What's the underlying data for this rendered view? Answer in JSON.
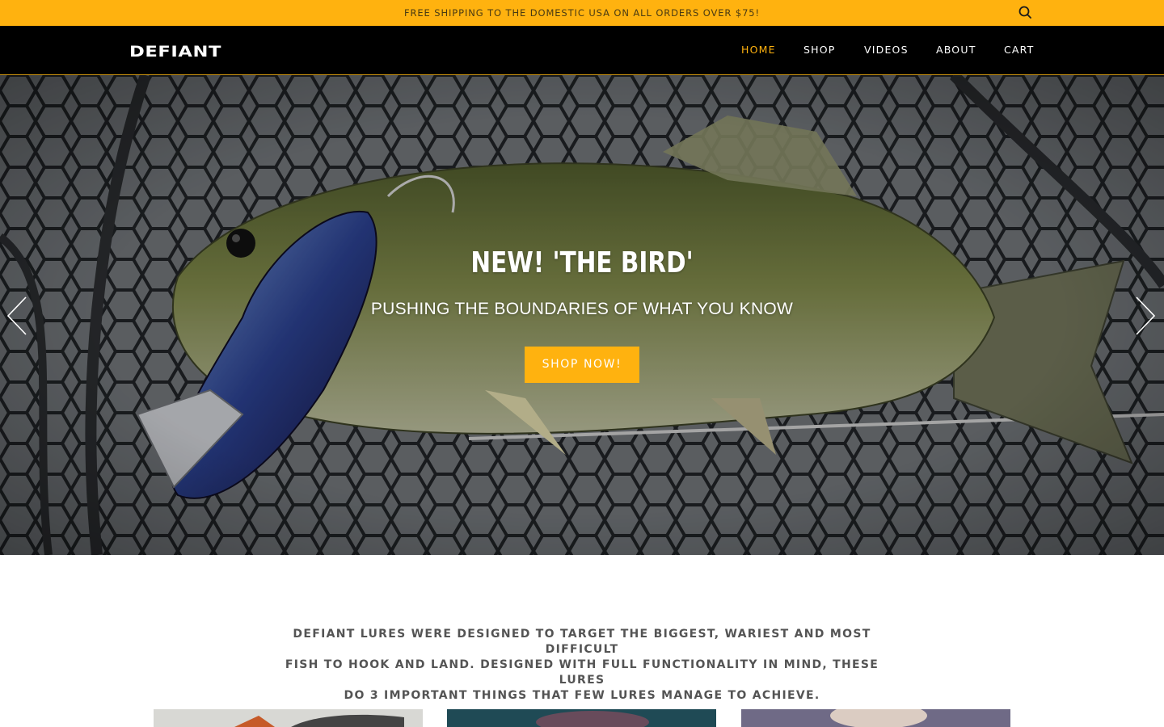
{
  "announcement": {
    "text": "FREE SHIPPING TO THE DOMESTIC USA ON ALL ORDERS OVER $75!",
    "search_icon": "search-icon"
  },
  "brand": {
    "logo_text": "DEFIANT",
    "accent_color": "#ffb20f"
  },
  "nav": {
    "items": [
      {
        "label": "HOME",
        "active": true
      },
      {
        "label": "SHOP",
        "active": false
      },
      {
        "label": "VIDEOS",
        "active": false
      },
      {
        "label": "ABOUT",
        "active": false
      },
      {
        "label": "CART",
        "active": false
      }
    ]
  },
  "hero": {
    "title": "NEW! 'THE BIRD'",
    "subtitle": "PUSHING THE BOUNDARIES OF WHAT YOU KNOW",
    "cta_label": "SHOP NOW!",
    "prev_icon": "chevron-left-icon",
    "next_icon": "chevron-right-icon"
  },
  "intro": {
    "line1": "DEFIANT LURES WERE DESIGNED TO TARGET THE BIGGEST, WARIEST AND MOST DIFFICULT",
    "line2": "FISH TO HOOK AND LAND. DESIGNED WITH FULL FUNCTIONALITY IN MIND, THESE LURES",
    "line3": "DO 3 IMPORTANT THINGS THAT FEW LURES MANAGE TO ACHIEVE."
  }
}
